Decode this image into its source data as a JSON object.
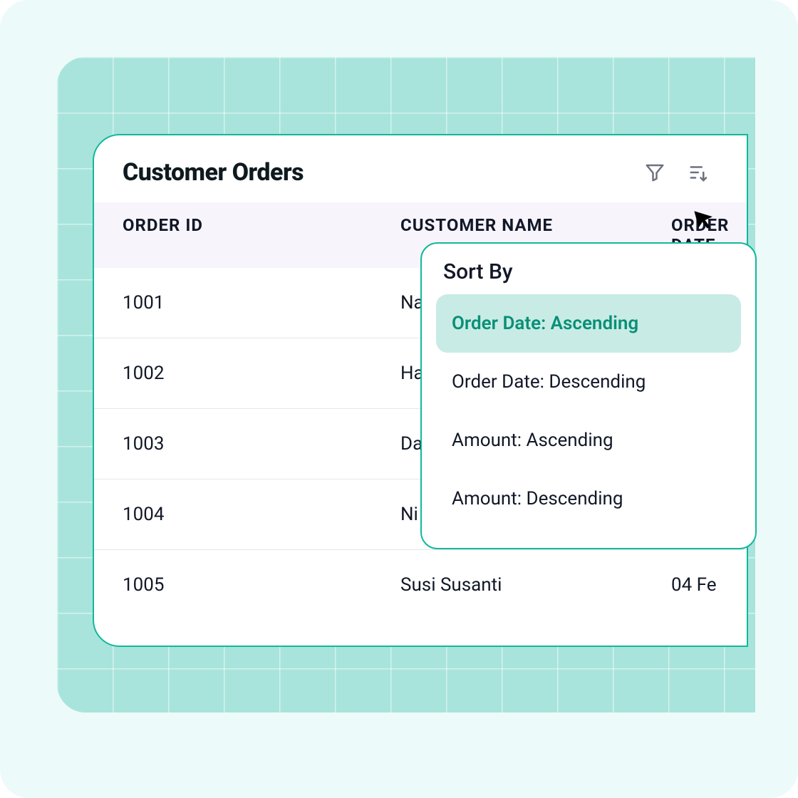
{
  "card": {
    "title": "Customer Orders",
    "columns": [
      "ORDER ID",
      "CUSTOMER NAME",
      "ORDER DATE"
    ],
    "rows": [
      {
        "id": "1001",
        "name": "Na",
        "date": ""
      },
      {
        "id": "1002",
        "name": "Ha",
        "date": ""
      },
      {
        "id": "1003",
        "name": "Da",
        "date": ""
      },
      {
        "id": "1004",
        "name": "Ni",
        "date": ""
      },
      {
        "id": "1005",
        "name": "Susi Susanti",
        "date": "04 Fe"
      }
    ]
  },
  "sort_dropdown": {
    "title": "Sort By",
    "options": [
      {
        "label": "Order Date: Ascending",
        "selected": true
      },
      {
        "label": "Order Date: Descending",
        "selected": false
      },
      {
        "label": "Amount: Ascending",
        "selected": false
      },
      {
        "label": "Amount: Descending",
        "selected": false
      }
    ]
  },
  "icons": {
    "filter": "filter-icon",
    "sort": "sort-icon",
    "cursor": "cursor-icon"
  },
  "colors": {
    "accent": "#12b89c",
    "accent_light": "#c8ece5",
    "bg_outer": "#ecfbf9",
    "bg_grid": "#a8e4db",
    "header_bg": "#f7f4fb"
  }
}
